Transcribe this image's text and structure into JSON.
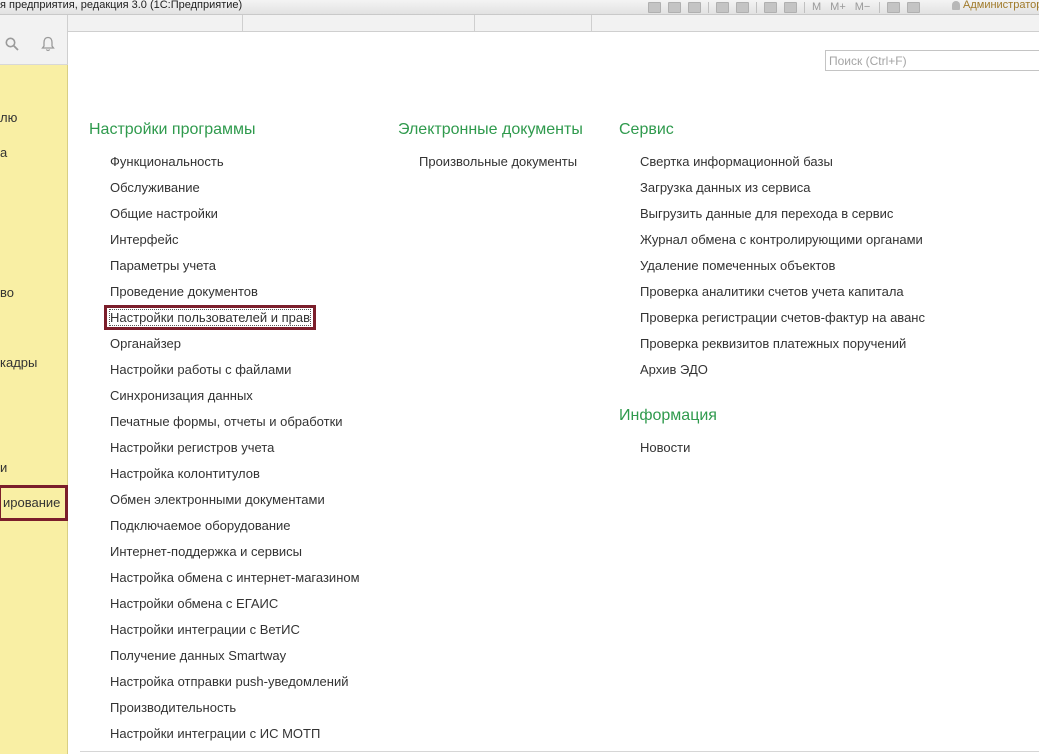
{
  "app": {
    "title": "я предприятия, редакция 3.0  (1С:Предприятие)",
    "user": "Администратор"
  },
  "toolbar": {
    "m": "M",
    "m_plus": "M+",
    "m_minus": "M−"
  },
  "sidebar": {
    "items": [
      {
        "label": "лю"
      },
      {
        "label": "а"
      },
      {
        "label": "во"
      },
      {
        "label": "кадры"
      },
      {
        "label": "и"
      },
      {
        "label": "ирование"
      }
    ]
  },
  "search": {
    "placeholder": "Поиск (Ctrl+F)"
  },
  "columns": {
    "settings": {
      "title": "Настройки программы",
      "links": [
        "Функциональность",
        "Обслуживание",
        "Общие настройки",
        "Интерфейс",
        "Параметры учета",
        "Проведение документов",
        "Настройки пользователей и прав",
        "Органайзер",
        "Настройки работы с файлами",
        "Синхронизация данных",
        "Печатные формы, отчеты и обработки",
        "Настройки регистров учета",
        "Настройка колонтитулов",
        "Обмен электронными документами",
        "Подключаемое оборудование",
        "Интернет-поддержка и сервисы",
        "Настройка обмена с интернет-магазином",
        "Настройки обмена с ЕГАИС",
        "Настройки интеграции с ВетИС",
        "Получение данных Smartway",
        "Настройка отправки push-уведомлений",
        "Производительность",
        "Настройки интеграции с ИС МОТП"
      ]
    },
    "edocs": {
      "title": "Электронные документы",
      "links": [
        "Произвольные документы"
      ]
    },
    "service": {
      "title": "Сервис",
      "links": [
        "Свертка информационной базы",
        "Загрузка данных из сервиса",
        "Выгрузить данные для перехода в сервис",
        "Журнал обмена с контролирующими органами",
        "Удаление помеченных объектов",
        "Проверка аналитики счетов учета капитала",
        "Проверка регистрации счетов-фактур на аванс",
        "Проверка реквизитов платежных поручений",
        "Архив ЭДО"
      ]
    },
    "info": {
      "title": "Информация",
      "links": [
        "Новости"
      ]
    }
  }
}
